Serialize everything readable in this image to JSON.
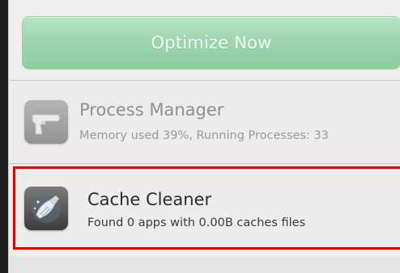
{
  "optimize_button": {
    "label": "Optimize Now"
  },
  "items": [
    {
      "title": "Process Manager",
      "subtitle": "Memory used 39%, Running Processes: 33",
      "icon": "pistol-icon"
    },
    {
      "title": "Cache Cleaner",
      "subtitle": "Found 0 apps with 0.00B caches files",
      "icon": "broom-icon"
    }
  ],
  "colors": {
    "button_green": "#9fd6b0",
    "highlight_red": "#d10a0a",
    "panel_bg": "#ececeb"
  }
}
